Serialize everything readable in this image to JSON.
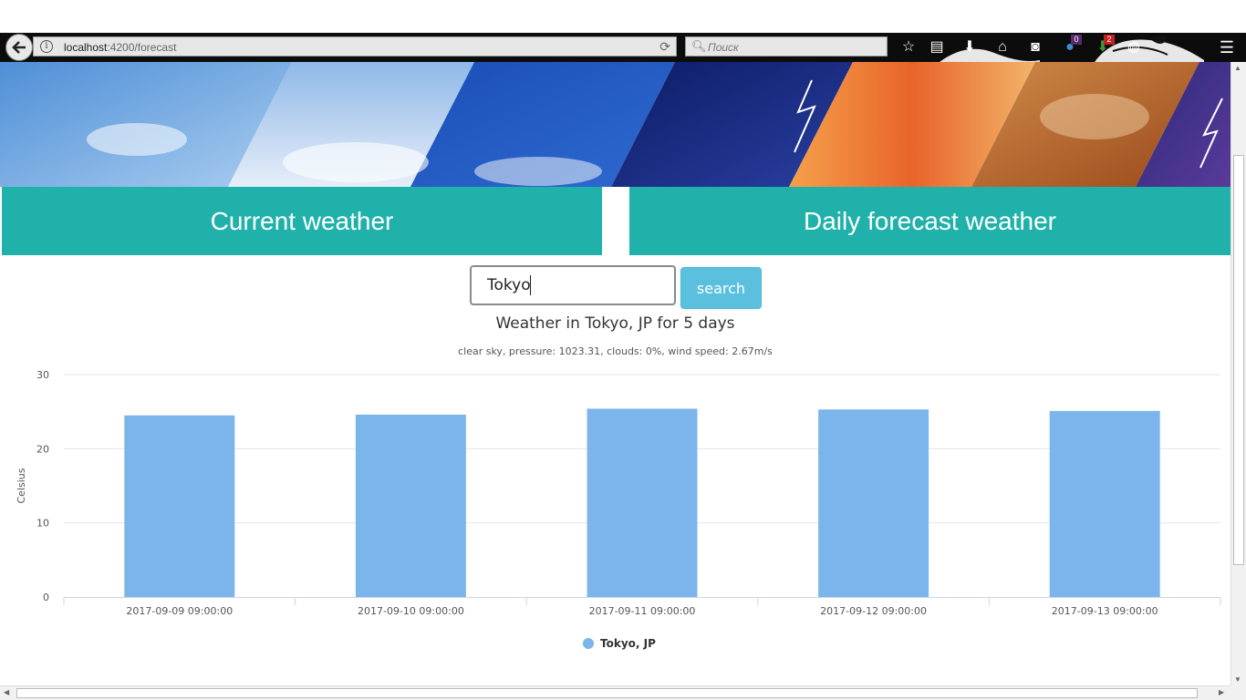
{
  "browser": {
    "url_host": "localhost",
    "url_rest": ":4200/forecast",
    "search_placeholder": "Поиск",
    "badge_counts": [
      "0",
      "2"
    ]
  },
  "nav": {
    "current_label": "Current weather",
    "daily_label": "Daily forecast weather"
  },
  "search": {
    "city_value": "Tokyo",
    "button_label": "search"
  },
  "accent_color": "#20b2aa",
  "chart_data": {
    "type": "bar",
    "title": "Weather in Tokyo, JP for 5 days",
    "subtitle": "clear sky, pressure: 1023.31, clouds: 0%, wind speed: 2.67m/s",
    "categories": [
      "2017-09-09 09:00:00",
      "2017-09-10 09:00:00",
      "2017-09-11 09:00:00",
      "2017-09-12 09:00:00",
      "2017-09-13 09:00:00"
    ],
    "series": [
      {
        "name": "Tokyo, JP",
        "values": [
          24.5,
          24.6,
          25.4,
          25.3,
          25.1
        ],
        "color": "#7cb5ec"
      }
    ],
    "xlabel": "",
    "ylabel": "Celsius",
    "ylim": [
      0,
      30
    ],
    "yticks": [
      "0",
      "10",
      "20",
      "30"
    ],
    "grid": true,
    "legend": "bottom-center"
  }
}
